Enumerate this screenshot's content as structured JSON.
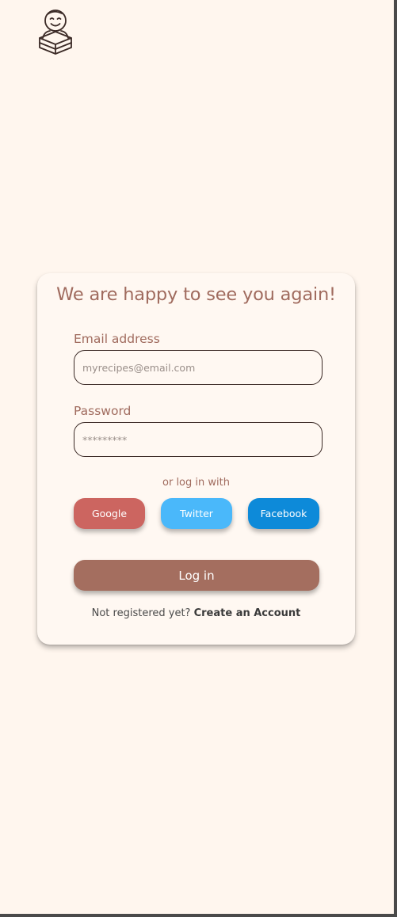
{
  "logo": {
    "icon": "chef-with-book-icon",
    "color": "#3b2a26"
  },
  "login_card": {
    "title": "We are happy to see you again!",
    "email_label": "Email address",
    "email_placeholder": "myrecipes@email.com",
    "email_value": "",
    "password_label": "Password",
    "password_placeholder": "*********",
    "password_value": "",
    "or_text": "or log in with",
    "social_buttons": [
      {
        "label": "Google",
        "color": "#cc6560"
      },
      {
        "label": "Twitter",
        "color": "#4ab8fa"
      },
      {
        "label": "Facebook",
        "color": "#0d8ad9"
      }
    ],
    "login_label": "Log in",
    "register_prompt": "Not registered yet?",
    "register_link": "Create an Account"
  },
  "colors": {
    "background": "#fff6ee",
    "card": "#fff8f2",
    "accent": "#a06b5e",
    "login_button": "#a46e5f"
  }
}
